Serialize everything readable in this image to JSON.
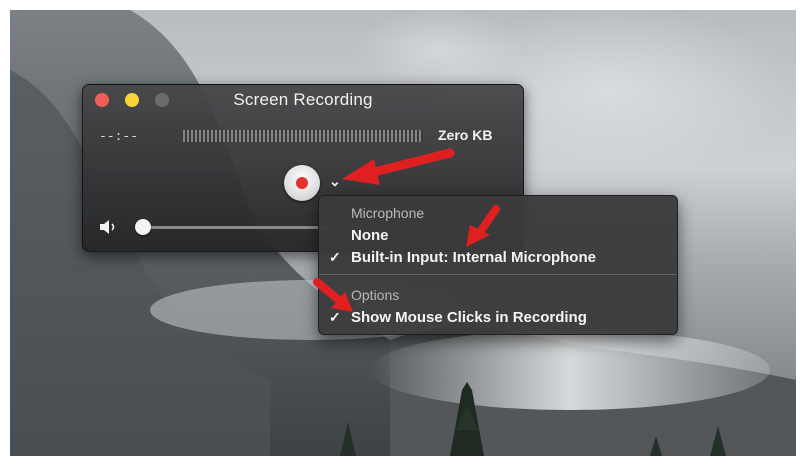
{
  "window": {
    "title": "Screen Recording",
    "elapsed_time": "--:--",
    "file_size": "Zero KB",
    "volume_level": 0.0
  },
  "menu": {
    "microphone_header": "Microphone",
    "microphone_items": [
      {
        "label": "None",
        "checked": false
      },
      {
        "label": "Built-in Input: Internal Microphone",
        "checked": true
      }
    ],
    "options_header": "Options",
    "options_items": [
      {
        "label": "Show Mouse Clicks in Recording",
        "checked": true
      }
    ],
    "check_glyph": "✓"
  },
  "icons": {
    "chevron": "⌄",
    "record": "record-icon",
    "speaker": "speaker-icon"
  },
  "colors": {
    "close": "#ee5d56",
    "minimize": "#f6d33a",
    "zoom": "#6b6b6b",
    "record_dot": "#e5322d",
    "annotation_arrow": "#e02020"
  }
}
